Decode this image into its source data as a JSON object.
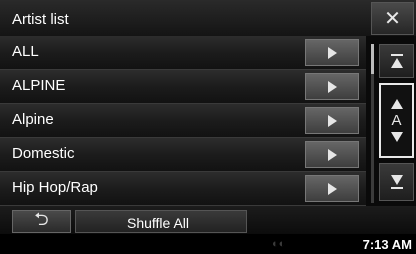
{
  "header": {
    "title": "Artist list",
    "close_icon": "close-icon"
  },
  "list": {
    "items": [
      {
        "label": "ALL"
      },
      {
        "label": "ALPINE"
      },
      {
        "label": "Alpine"
      },
      {
        "label": "Domestic"
      },
      {
        "label": "Hip Hop/Rap"
      }
    ],
    "play_icon": "play-triangle-icon"
  },
  "side": {
    "page_up_icon": "page-up-icon",
    "alpha_letter": "A",
    "alpha_up_icon": "triangle-up-icon",
    "alpha_down_icon": "triangle-down-icon",
    "page_down_icon": "page-down-icon"
  },
  "footer": {
    "back_icon": "back-arrow-icon",
    "shuffle_label": "Shuffle All"
  },
  "status": {
    "time": "7:13 AM",
    "indicator": "◐◐"
  }
}
